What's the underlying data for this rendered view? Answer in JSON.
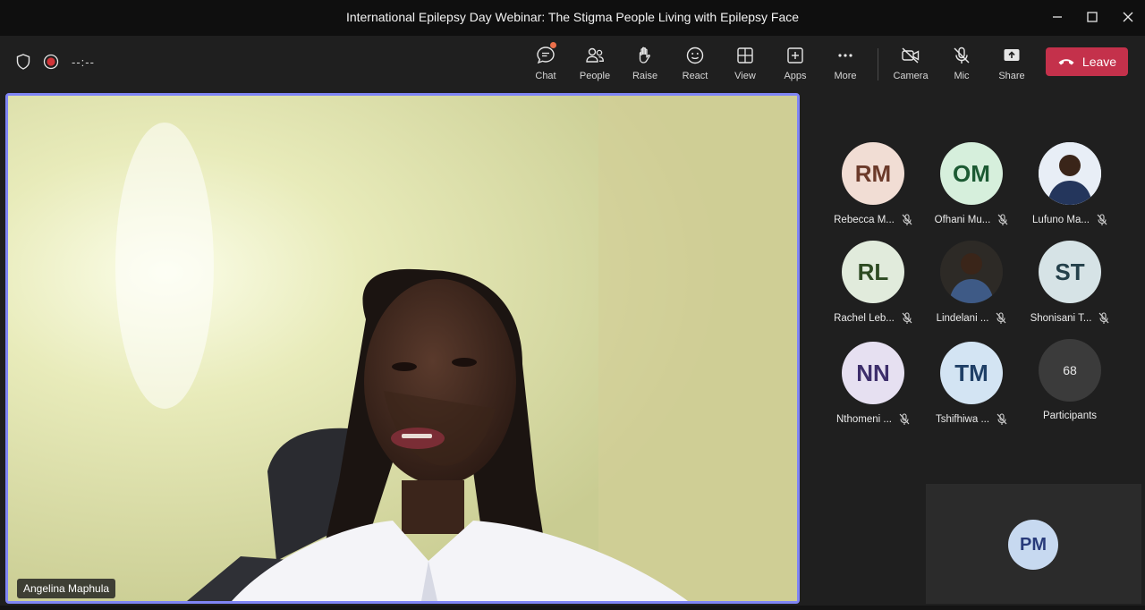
{
  "window": {
    "title": "International Epilepsy Day Webinar: The Stigma People Living with Epilepsy Face"
  },
  "toolbar": {
    "timer": "--:--",
    "buttons": [
      {
        "id": "chat",
        "label": "Chat",
        "icon": "chat-icon"
      },
      {
        "id": "people",
        "label": "People",
        "icon": "people-icon"
      },
      {
        "id": "raise",
        "label": "Raise",
        "icon": "hand-icon"
      },
      {
        "id": "react",
        "label": "React",
        "icon": "smile-icon"
      },
      {
        "id": "view",
        "label": "View",
        "icon": "grid-icon"
      },
      {
        "id": "apps",
        "label": "Apps",
        "icon": "plus-square-icon"
      },
      {
        "id": "more",
        "label": "More",
        "icon": "more-icon"
      },
      {
        "id": "camera",
        "label": "Camera",
        "icon": "camera-off-icon"
      },
      {
        "id": "mic",
        "label": "Mic",
        "icon": "mic-off-icon"
      },
      {
        "id": "share",
        "label": "Share",
        "icon": "share-icon"
      }
    ],
    "leave_label": "Leave"
  },
  "stage": {
    "speaker_name": "Angelina Maphula"
  },
  "participants": [
    {
      "initials": "RM",
      "name": "Rebecca M...",
      "bg": "#f1ddd4",
      "fg": "#6b3a2a",
      "photo": false
    },
    {
      "initials": "OM",
      "name": "Ofhani Mu...",
      "bg": "#d6efdc",
      "fg": "#1c5a33",
      "photo": false
    },
    {
      "initials": "",
      "name": "Lufuno Ma...",
      "bg": "#e8eef6",
      "fg": "#222",
      "photo": true
    },
    {
      "initials": "RL",
      "name": "Rachel Leb...",
      "bg": "#e1ebdc",
      "fg": "#2d4a22",
      "photo": false
    },
    {
      "initials": "",
      "name": "Lindelani ...",
      "bg": "#2d2a26",
      "fg": "#fff",
      "photo": true
    },
    {
      "initials": "ST",
      "name": "Shonisani T...",
      "bg": "#d6e3e6",
      "fg": "#24404a",
      "photo": false
    },
    {
      "initials": "NN",
      "name": "Nthomeni ...",
      "bg": "#e6e0f1",
      "fg": "#3d2e6b",
      "photo": false
    },
    {
      "initials": "TM",
      "name": "Tshifhiwa ...",
      "bg": "#d3e4f3",
      "fg": "#1f3f66",
      "photo": false
    }
  ],
  "overflow": {
    "count": "68",
    "label": "Participants"
  },
  "self": {
    "initials": "PM"
  },
  "colors": {
    "accent": "#7f85f5",
    "leave": "#c4314b"
  }
}
